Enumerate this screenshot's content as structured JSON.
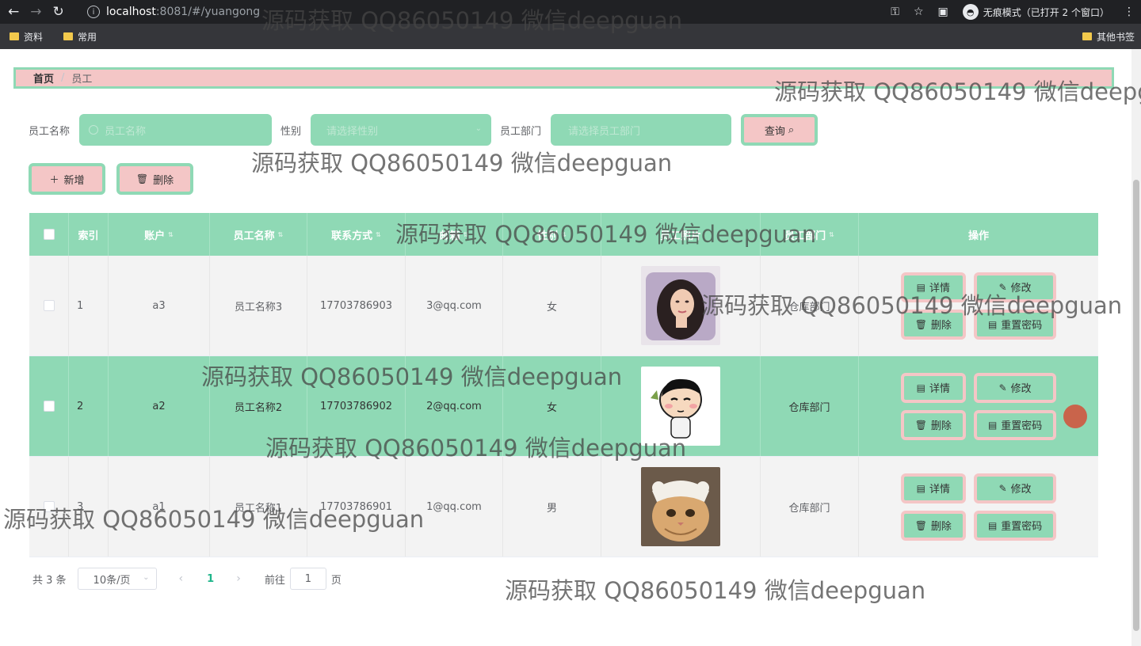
{
  "browser": {
    "url_host": "localhost",
    "url_port": ":8081",
    "url_path": "/#/yuangong",
    "incognito_label": "无痕模式（已打开 2 个窗口）",
    "bookmarks": [
      "资料",
      "常用"
    ],
    "other_bookmarks": "其他书签"
  },
  "breadcrumb": {
    "home": "首页",
    "sep": "/",
    "current": "员工"
  },
  "search": {
    "name_label": "员工名称",
    "name_placeholder": "员工名称",
    "gender_label": "性别",
    "gender_placeholder": "请选择性别",
    "dept_label": "员工部门",
    "dept_placeholder": "请选择员工部门",
    "query_button": "查询"
  },
  "actions": {
    "add": "新增",
    "delete": "删除"
  },
  "table": {
    "headers": [
      "索引",
      "账户",
      "员工名称",
      "联系方式",
      "邮箱",
      "性别",
      "员工照片",
      "员工部门",
      "操作"
    ],
    "rows": [
      {
        "index": "1",
        "account": "a3",
        "name": "员工名称3",
        "phone": "17703786903",
        "email": "3@qq.com",
        "gender": "女",
        "dept": "仓库部门",
        "photo": "portrait-woman"
      },
      {
        "index": "2",
        "account": "a2",
        "name": "员工名称2",
        "phone": "17703786902",
        "email": "2@qq.com",
        "gender": "女",
        "dept": "仓库部门",
        "photo": "cartoon-boy"
      },
      {
        "index": "3",
        "account": "a1",
        "name": "员工名称1",
        "phone": "17703786901",
        "email": "1@qq.com",
        "gender": "男",
        "dept": "仓库部门",
        "photo": "cat"
      }
    ],
    "row_actions": {
      "detail": "详情",
      "edit": "修改",
      "delete": "删除",
      "reset": "重置密码"
    }
  },
  "pagination": {
    "total": "共 3 条",
    "page_size": "10条/页",
    "current": "1",
    "goto_prefix": "前往",
    "goto_value": "1",
    "goto_suffix": "页"
  },
  "watermark": "源码获取 QQ86050149 微信deepguan",
  "colors": {
    "mint": "#8fd9b5",
    "pink": "#f4c6c6",
    "chrome": "#202124"
  }
}
